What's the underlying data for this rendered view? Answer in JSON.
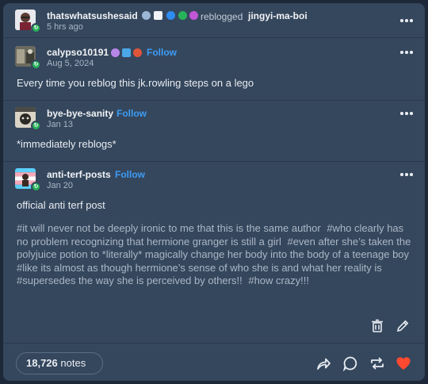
{
  "reblog_header": {
    "blog_name": "thatswhatsushesaid",
    "reblogged_label": "reblogged",
    "source_blog": "jingyi-ma-boi",
    "time_ago": "5 hrs ago"
  },
  "posts": [
    {
      "blog_name": "calypso10191",
      "follow_label": "Follow",
      "date": "Aug 5, 2024",
      "text": "Every time you reblog this jk.rowling steps on a lego"
    },
    {
      "blog_name": "bye-bye-sanity",
      "follow_label": "Follow",
      "date": "Jan 13",
      "text": "*immediately reblogs*"
    },
    {
      "blog_name": "anti-terf-posts",
      "follow_label": "Follow",
      "date": "Jan 20",
      "text": "official anti terf post"
    }
  ],
  "tags": [
    "#it will never not be deeply ironic to me that this is the same author",
    "#who clearly has no problem recognizing that hermione granger is still a girl",
    "#even after she’s taken the polyjuice potion to *literally* magically change her body into the body of a teenage boy",
    "#like its almost as though hermione’s sense of who she is and what her reality is",
    "#supersedes the way she is perceived by others!!",
    "#how crazy!!!"
  ],
  "footer": {
    "notes_count": "18,726",
    "notes_label": "notes"
  },
  "colors": {
    "card_bg": "#35475d",
    "page_bg": "#1d2838",
    "follow_blue": "#3d9cf5",
    "like_red": "#ff4930",
    "reblog_green": "#27b35a"
  },
  "icons": [
    "kebab-menu-icon",
    "delete-icon",
    "edit-icon",
    "share-icon",
    "reply-icon",
    "reblog-icon",
    "like-heart-icon"
  ]
}
